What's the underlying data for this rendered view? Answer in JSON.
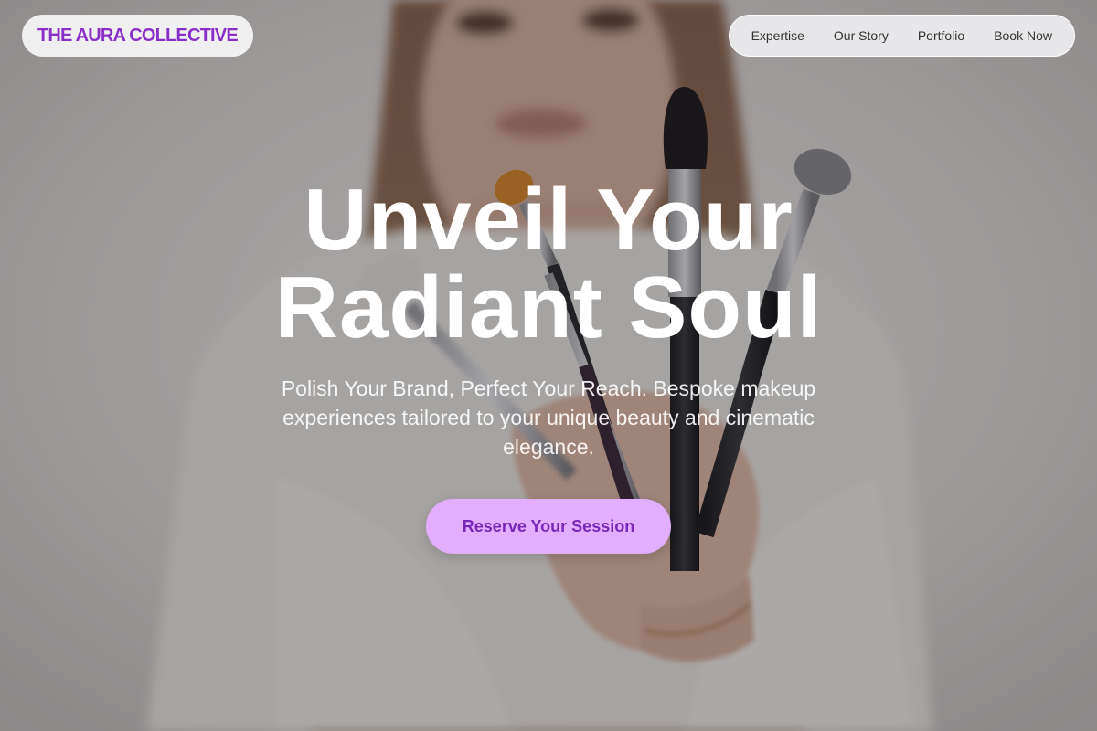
{
  "brand": {
    "logo_text": "THE AURA COLLECTIVE"
  },
  "nav": {
    "items": [
      {
        "label": "Expertise"
      },
      {
        "label": "Our Story"
      },
      {
        "label": "Portfolio"
      },
      {
        "label": "Book Now"
      }
    ]
  },
  "hero": {
    "headline_line1": "Unveil Your",
    "headline_line2": "Radiant Soul",
    "subtext": "Polish Your Brand, Perfect Your Reach. Bespoke makeup experiences tailored to your unique beauty and cinematic elegance.",
    "cta_label": "Reserve Your Session"
  },
  "colors": {
    "accent": "#8b2fc9",
    "cta_background": "#e3aeff",
    "cta_text": "#7a26b8",
    "headline": "#ffffff"
  }
}
